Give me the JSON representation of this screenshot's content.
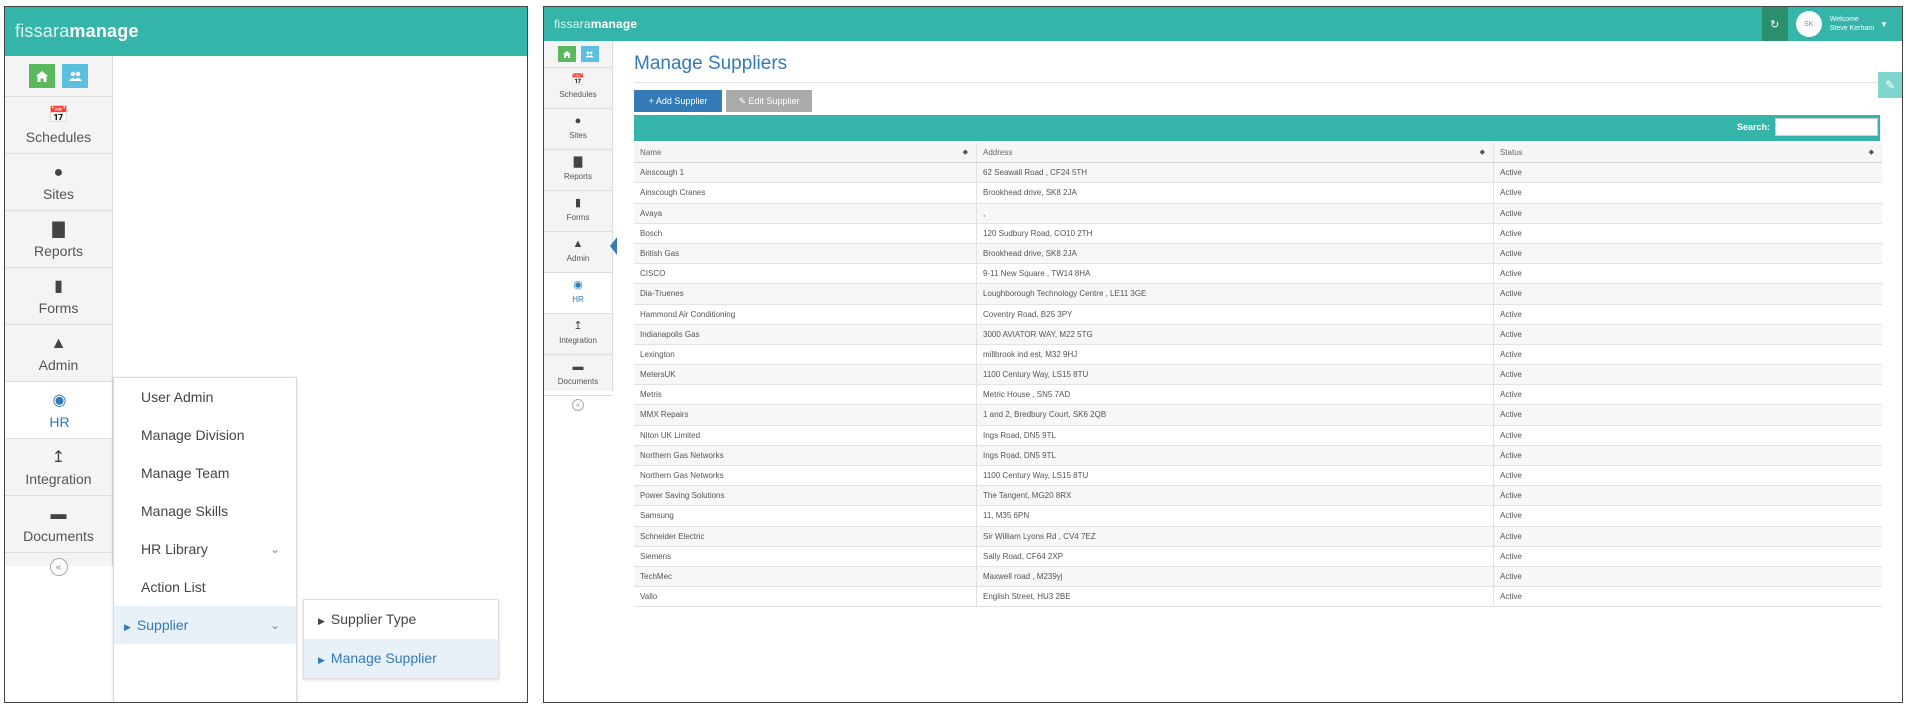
{
  "app": {
    "logo_thin": "fissara",
    "logo_bold": "manage"
  },
  "sidebar": {
    "items": [
      {
        "label": "Schedules",
        "icon": "calendar-icon"
      },
      {
        "label": "Sites",
        "icon": "globe-icon"
      },
      {
        "label": "Reports",
        "icon": "bar-chart-icon"
      },
      {
        "label": "Forms",
        "icon": "file-icon"
      },
      {
        "label": "Admin",
        "icon": "user-icon"
      },
      {
        "label": "HR",
        "icon": "users-icon"
      },
      {
        "label": "Integration",
        "icon": "upload-icon"
      },
      {
        "label": "Documents",
        "icon": "folder-icon"
      }
    ]
  },
  "hr_menu": {
    "items": [
      "User Admin",
      "Manage Division",
      "Manage Team",
      "Manage Skills",
      "HR Library",
      "Action List",
      "Supplier"
    ]
  },
  "supplier_menu": {
    "items": [
      "Supplier Type",
      "Manage Supplier"
    ]
  },
  "user": {
    "welcome": "Welcome",
    "name": "Steve Kerham",
    "avatar_text": "SK"
  },
  "page": {
    "title": "Manage Suppliers",
    "add_button": "+ Add Supplier",
    "edit_button": "Edit Supplier",
    "search_label": "Search:",
    "search_value": ""
  },
  "table": {
    "columns": [
      "Name",
      "Address",
      "Status"
    ],
    "rows": [
      [
        "Ainscough 1",
        "62 Seawall Road , CF24 5TH",
        "Active"
      ],
      [
        "Ainscough Cranes",
        "Brookhead drive, SK8 2JA",
        "Active"
      ],
      [
        "Avaya",
        ",",
        "Active"
      ],
      [
        "Bosch",
        "120 Sudbury Road, CO10 2TH",
        "Active"
      ],
      [
        "British Gas",
        "Brookhead drive, SK8 2JA",
        "Active"
      ],
      [
        "CISCO",
        "9-11 New Square , TW14 8HA",
        "Active"
      ],
      [
        "Dia-Truenes",
        "Loughborough Technology Centre , LE11 3GE",
        "Active"
      ],
      [
        "Hammond Air Conditioning",
        "Coventry Road, B25 3PY",
        "Active"
      ],
      [
        "Indianapolis Gas",
        "3000 AVIATOR WAY, M22 5TG",
        "Active"
      ],
      [
        "Lexington",
        "millbrook ind est, M32 9HJ",
        "Active"
      ],
      [
        "MetersUK",
        "1100 Century Way, LS15 8TU",
        "Active"
      ],
      [
        "Metris",
        "Metric House , SN5 7AD",
        "Active"
      ],
      [
        "MMX Repairs",
        "1 and 2, Bredbury Court, SK6 2QB",
        "Active"
      ],
      [
        "Niton UK Limited",
        "Ings Road, DN5 9TL",
        "Active"
      ],
      [
        "Northern Gas Networks",
        "Ings Road, DN5 9TL",
        "Active"
      ],
      [
        "Northern Gas Networks",
        "1100 Century Way, LS15 8TU",
        "Active"
      ],
      [
        "Power Saving Solutions",
        "The Tangent, MG20 8RX",
        "Active"
      ],
      [
        "Samsung",
        "11, M35 6PN",
        "Active"
      ],
      [
        "Schneider Electric",
        "Sir William Lyons Rd , CV4 7EZ",
        "Active"
      ],
      [
        "Siemens",
        "Sally Road, CF64 2XP",
        "Active"
      ],
      [
        "TechMec",
        "Maxwell road , M239yj",
        "Active"
      ],
      [
        "Vallo",
        "English Street, HU3 2BE",
        "Active"
      ]
    ]
  },
  "colors": {
    "header_teal": "#35b5aa",
    "accent_blue": "#337ab7",
    "home_green": "#5cb85c"
  }
}
